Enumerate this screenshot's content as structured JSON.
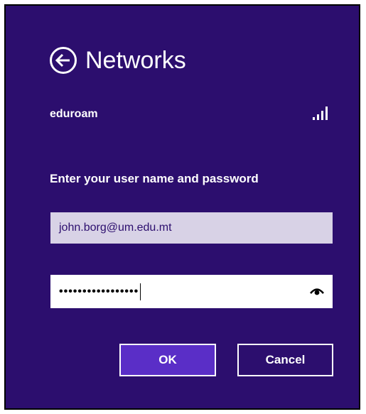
{
  "header": {
    "title": "Networks",
    "back_icon": "back-arrow-icon"
  },
  "network": {
    "name": "eduroam",
    "signal_icon": "wifi-signal-icon"
  },
  "form": {
    "prompt": "Enter your user name and password",
    "username_value": "john.borg@um.edu.mt",
    "password_mask": "•••••••••••••••••",
    "reveal_icon": "reveal-password-icon"
  },
  "buttons": {
    "ok_label": "OK",
    "cancel_label": "Cancel"
  },
  "colors": {
    "background": "#2c0e6e",
    "accent": "#5a2ec7",
    "username_field": "#d8d2e6"
  }
}
